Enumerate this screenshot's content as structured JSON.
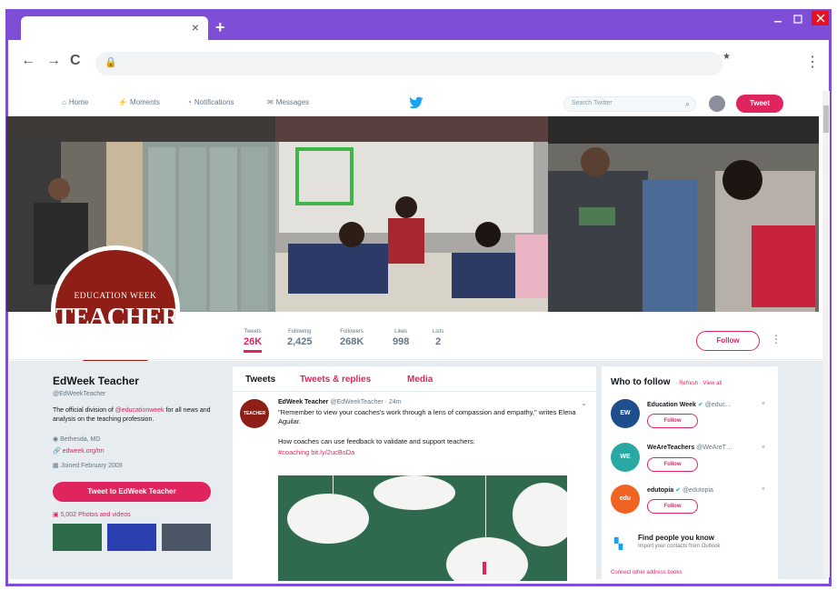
{
  "browser": {
    "tab_title": "",
    "tab_close": "×",
    "new_tab": "+",
    "back": "←",
    "forward": "→",
    "reload": "C",
    "lock": "🔒",
    "menu": "⋮",
    "star": "★"
  },
  "twitter_nav": {
    "home": "Home",
    "moments": "Moments",
    "notifications": "Notifications",
    "messages": "Messages",
    "search_placeholder": "Search Twitter",
    "tweet_button": "Tweet"
  },
  "profile": {
    "logo_line1": "EDUCATION WEEK",
    "logo_line2": "TEACHER",
    "name": "EdWeek Teacher",
    "handle": "@EdWeekTeacher",
    "bio_prefix": "The official division of ",
    "bio_mention": "@educationweek",
    "bio_suffix": " for all news and analysis on the teaching profession.",
    "location": "Bethesda, MD",
    "website": "edweek.org/tm",
    "joined": "Joined February 2009",
    "tweet_to": "Tweet to EdWeek Teacher",
    "photos": "5,002 Photos and videos"
  },
  "stats": {
    "tweets_label": "Tweets",
    "tweets_value": "26K",
    "following_label": "Following",
    "following_value": "2,425",
    "followers_label": "Followers",
    "followers_value": "268K",
    "likes_label": "Likes",
    "likes_value": "998",
    "lists_label": "Lists",
    "lists_value": "2",
    "follow_button": "Follow",
    "more": "⋮"
  },
  "timeline": {
    "tab_tweets": "Tweets",
    "tab_replies": "Tweets & replies",
    "tab_media": "Media",
    "tweet": {
      "avatar_text": "TEACHER",
      "author": "EdWeek Teacher",
      "handle_time": "@EdWeekTeacher · 24m",
      "text": "\"Remember to view your coaches's work through a lens of compassion and empathy,\" writes Elena Aguilar.",
      "text2": "How coaches can use feedback to validate and support teachers:",
      "tags": "#coaching bit.ly/2ucBsDa",
      "caret": "⌄"
    }
  },
  "who_to_follow": {
    "title": "Who to follow",
    "refresh": "· Refresh · View all",
    "accounts": [
      {
        "avatar": "EW",
        "name": "Education Week",
        "handle": "@educ…",
        "follow": "Follow",
        "color": "#1f4e8c"
      },
      {
        "avatar": "WE",
        "name": "WeAreTeachers",
        "handle": "@WeAreT…",
        "follow": "Follow",
        "color": "#2aa9a4"
      },
      {
        "avatar": "edu",
        "name": "edutopia",
        "handle": "@edutopia",
        "follow": "Follow",
        "color": "#f06423"
      }
    ],
    "dismiss": "×",
    "find_title": "Find people you know",
    "find_sub": "Import your contacts from Outlook",
    "connect": "Connect other address books"
  },
  "colors": {
    "accent": "#e0245e",
    "chrome": "#7e4fd6",
    "twitter_blue": "#1da1f2"
  }
}
